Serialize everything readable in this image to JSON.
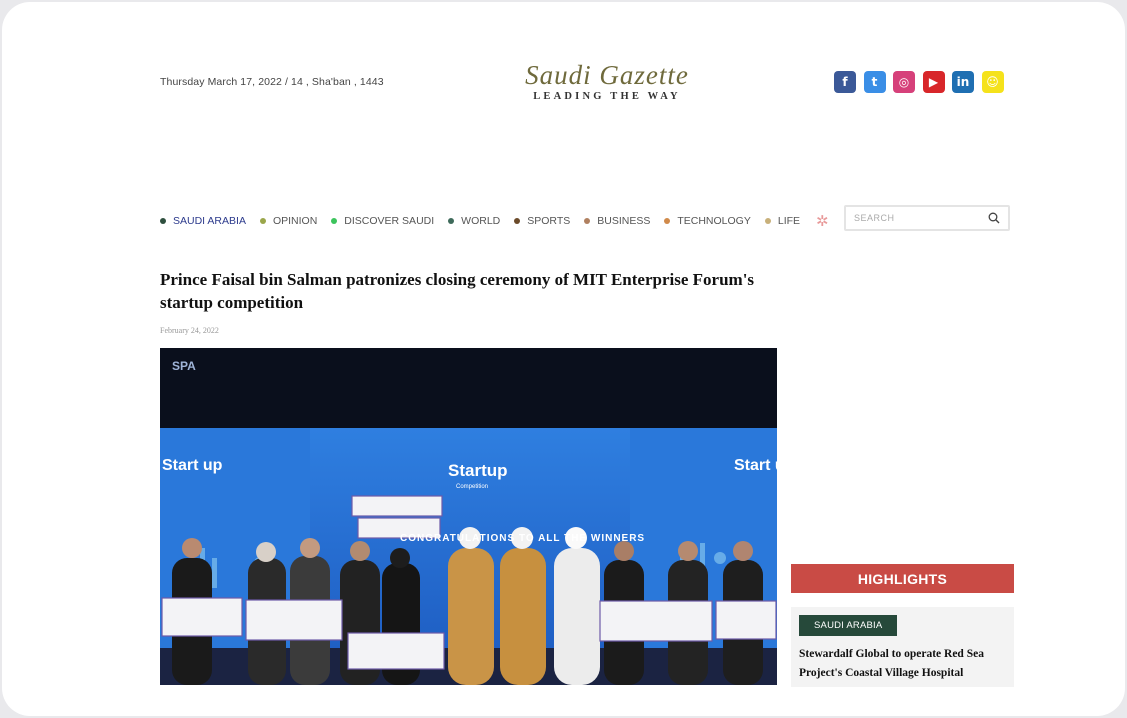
{
  "header": {
    "date": "Thursday March 17, 2022 / 14 , Sha'ban , 1443",
    "logo_name": "Saudi Gazette",
    "logo_tagline": "LEADING THE WAY"
  },
  "socials": [
    {
      "name": "facebook",
      "glyph": "f",
      "color": "#3b5998"
    },
    {
      "name": "twitter",
      "glyph": "t",
      "color": "#3a8ee6"
    },
    {
      "name": "instagram",
      "glyph": "◎",
      "color": "#d6407a"
    },
    {
      "name": "youtube",
      "glyph": "▶",
      "color": "#d8262a"
    },
    {
      "name": "linkedin",
      "glyph": "in",
      "color": "#1f6fb2"
    },
    {
      "name": "snapchat",
      "glyph": "☺",
      "color": "#f5e21b"
    }
  ],
  "nav": [
    {
      "label": "SAUDI ARABIA",
      "color": "#2e4f3e",
      "active": true
    },
    {
      "label": "OPINION",
      "color": "#9aa64a"
    },
    {
      "label": "DISCOVER SAUDI",
      "color": "#3cc45c"
    },
    {
      "label": "WORLD",
      "color": "#3e6a5a"
    },
    {
      "label": "SPORTS",
      "color": "#6b4a2a"
    },
    {
      "label": "BUSINESS",
      "color": "#b08060"
    },
    {
      "label": "TECHNOLOGY",
      "color": "#d08a4a"
    },
    {
      "label": "LIFE",
      "color": "#c8b07a"
    }
  ],
  "search": {
    "placeholder": "SEARCH"
  },
  "article": {
    "headline": "Prince Faisal bin Salman patronizes closing ceremony of MIT Enterprise Forum's startup competition",
    "date": "February 24, 2022",
    "photo": {
      "watermark": "SPA",
      "screen_logo": "Startup",
      "screen_logo_sub": "Competition",
      "screen_banner": "CONGRATULATIONS TO ALL THE WINNERS",
      "side_logo": "Start up"
    }
  },
  "sidebar": {
    "highlights_label": "HIGHLIGHTS",
    "card": {
      "category": "SAUDI ARABIA",
      "title": "Stewardalf Global to operate Red Sea Project's Coastal Village Hospital"
    }
  }
}
